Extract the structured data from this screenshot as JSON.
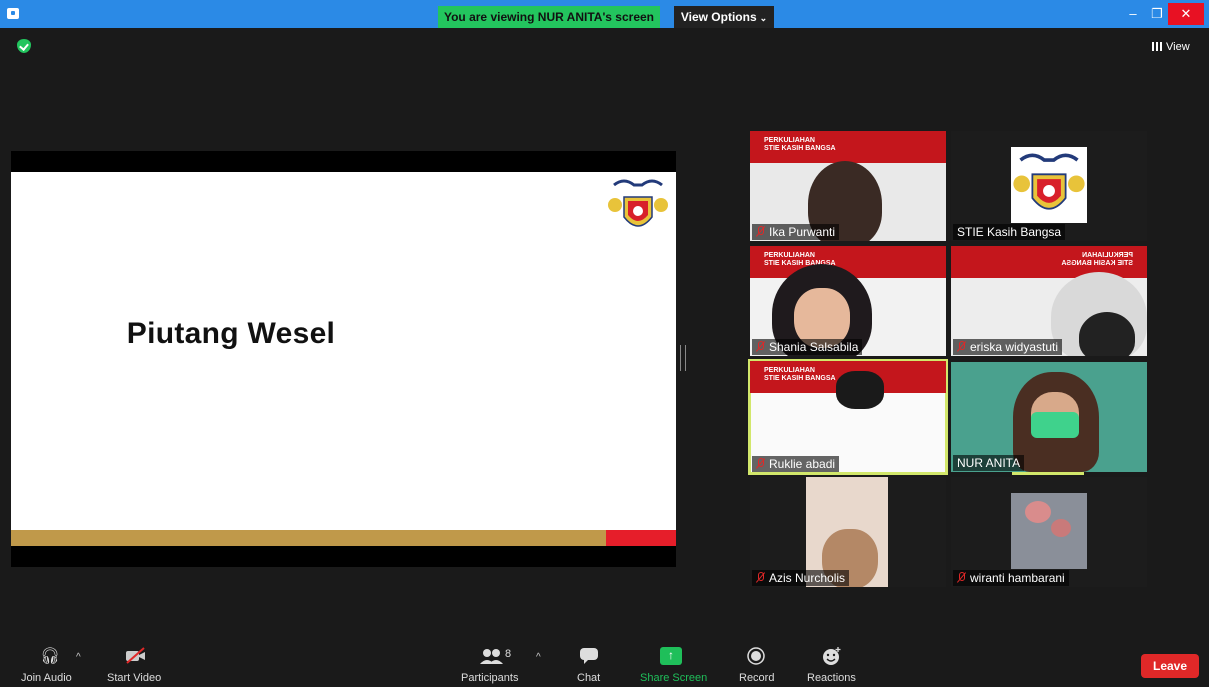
{
  "titlebar": {
    "viewing_banner": "You are viewing NUR ANITA's screen",
    "view_options": "View Options",
    "minimize": "–",
    "restore": "❐",
    "close": "✕"
  },
  "top": {
    "view_label": "View"
  },
  "slide": {
    "title": "Piutang Wesel"
  },
  "gallery": [
    {
      "name": "Ika Purwanti",
      "muted": true,
      "banner": "PERKULIAHAN\nSTIE KASIH BANGSA"
    },
    {
      "name": "STIE Kasih Bangsa",
      "muted": false
    },
    {
      "name": "Shania Salsabila",
      "muted": true,
      "banner": "PERKULIAHAN\nSTIE KASIH BANGSA"
    },
    {
      "name": "eriska widyastuti",
      "muted": true,
      "banner": "PERKULIAHAN\nSTIE KASIH BANGSA"
    },
    {
      "name": "Ruklie abadi",
      "muted": true,
      "banner": "PERKULIAHAN\nSTIE KASIH BANGSA",
      "active": true
    },
    {
      "name": "NUR ANITA",
      "muted": false
    },
    {
      "name": "Azis Nurcholis",
      "muted": true
    },
    {
      "name": "wiranti hambarani",
      "muted": true
    }
  ],
  "toolbar": {
    "join_audio": "Join Audio",
    "start_video": "Start Video",
    "participants": "Participants",
    "participants_count": "8",
    "chat": "Chat",
    "share_screen": "Share Screen",
    "record": "Record",
    "reactions": "Reactions",
    "leave": "Leave"
  },
  "colors": {
    "titlebar": "#2b8ae6",
    "banner_green": "#23c55e",
    "active_speaker": "#d2e76b",
    "leave_red": "#e02828",
    "share_green": "#1fbf5a",
    "slide_gold": "#c0994a",
    "slide_red": "#e61e2a"
  }
}
